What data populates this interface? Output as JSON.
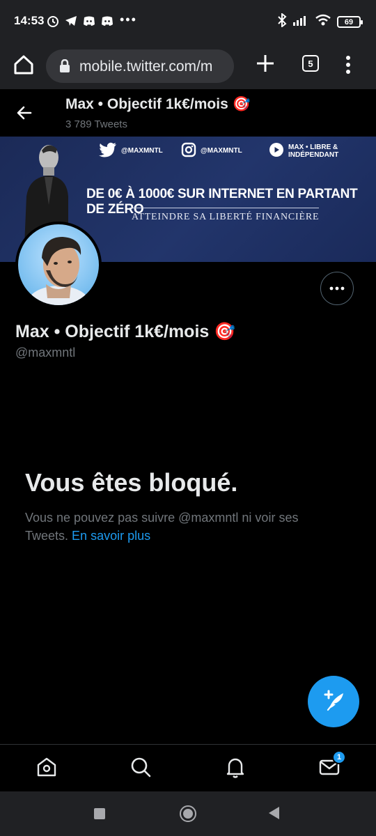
{
  "status_bar": {
    "time": "14:53",
    "dots": "•••",
    "battery": "69",
    "icons": [
      "alarm-icon",
      "telegram-icon",
      "discord-icon",
      "discord-icon",
      "bluetooth-icon",
      "signal-icon",
      "wifi-icon",
      "battery-icon"
    ]
  },
  "browser": {
    "url": "mobile.twitter.com/m",
    "tab_count": "5"
  },
  "header": {
    "name": "Max • Objectif 1k€/mois 🎯",
    "tweet_count": "3 789 Tweets"
  },
  "banner": {
    "twitter_handle": "@MAXMNTL",
    "instagram_handle": "@MAXMNTL",
    "youtube_text": "MAX • LIBRE & INDÉPENDANT",
    "headline": "DE 0€ À 1000€ SUR INTERNET EN PARTANT DE ZÉRO",
    "subline": "ATTEINDRE SA LIBERTÉ FINANCIÈRE"
  },
  "profile": {
    "name": "Max • Objectif 1k€/mois 🎯",
    "handle": "@maxmntl"
  },
  "blocked": {
    "title": "Vous êtes bloqué.",
    "text": "Vous ne pouvez pas suivre @maxmntl ni voir ses Tweets.",
    "link": "En savoir plus"
  },
  "bottom_nav": {
    "messages_badge": "1"
  },
  "colors": {
    "accent": "#1d9bf0",
    "background": "#000000",
    "muted": "#71767b"
  }
}
